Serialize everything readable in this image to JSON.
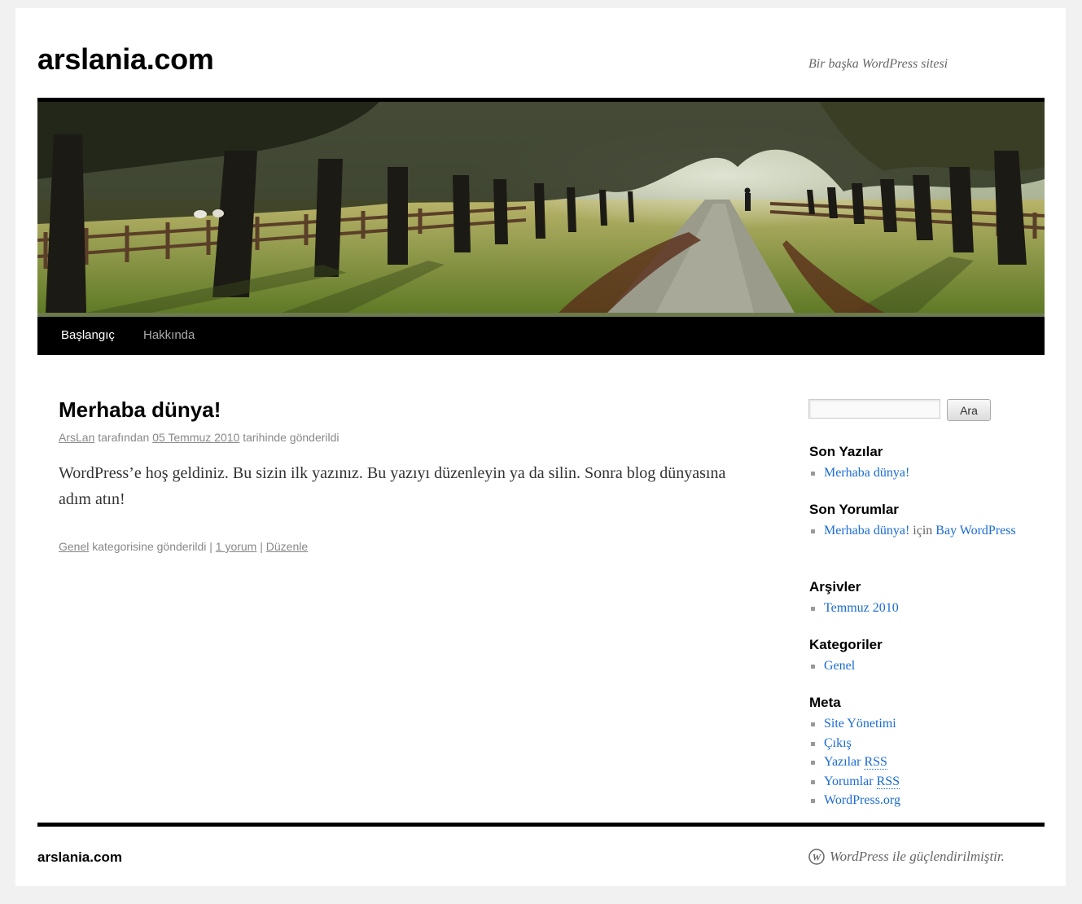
{
  "site": {
    "title": "arslania.com",
    "description": "Bir başka WordPress sitesi"
  },
  "nav": {
    "items": [
      {
        "label": "Başlangıç",
        "current": true
      },
      {
        "label": "Hakkında",
        "current": false
      }
    ]
  },
  "post": {
    "title": "Merhaba dünya!",
    "author": "ArsLan",
    "by_text": " tarafından ",
    "date": "05 Temmuz 2010",
    "posted_text": " tarihinde gönderildi",
    "content": "WordPress’e hoş geldiniz. Bu sizin ilk yazınız. Bu yazıyı düzenleyin ya da silin. Sonra blog dünyasına adım atın!",
    "category": "Genel",
    "category_text": " kategorisine gönderildi | ",
    "comments": "1 yorum",
    "separator": " | ",
    "edit": "Düzenle"
  },
  "sidebar": {
    "search": {
      "placeholder": "",
      "button": "Ara"
    },
    "recent_posts": {
      "title": "Son Yazılar",
      "items": [
        "Merhaba dünya!"
      ]
    },
    "recent_comments": {
      "title": "Son Yorumlar",
      "post": "Merhaba dünya!",
      "for_text": " için ",
      "author": "Bay WordPress"
    },
    "archives": {
      "title": "Arşivler",
      "items": [
        "Temmuz 2010"
      ]
    },
    "categories": {
      "title": "Kategoriler",
      "items": [
        "Genel"
      ]
    },
    "meta": {
      "title": "Meta",
      "site_admin": "Site Yönetimi",
      "logout": "Çıkış",
      "posts_word": "Yazılar",
      "comments_word": "Yorumlar",
      "rss": "RSS",
      "wordpress_org": "WordPress.org"
    }
  },
  "footer": {
    "title": "arslania.com",
    "generator": "WordPress ile güçlendirilmiştir."
  },
  "colors": {
    "link": "#1a6bd3",
    "nav_bg": "#000000",
    "meta_text": "#888888"
  }
}
